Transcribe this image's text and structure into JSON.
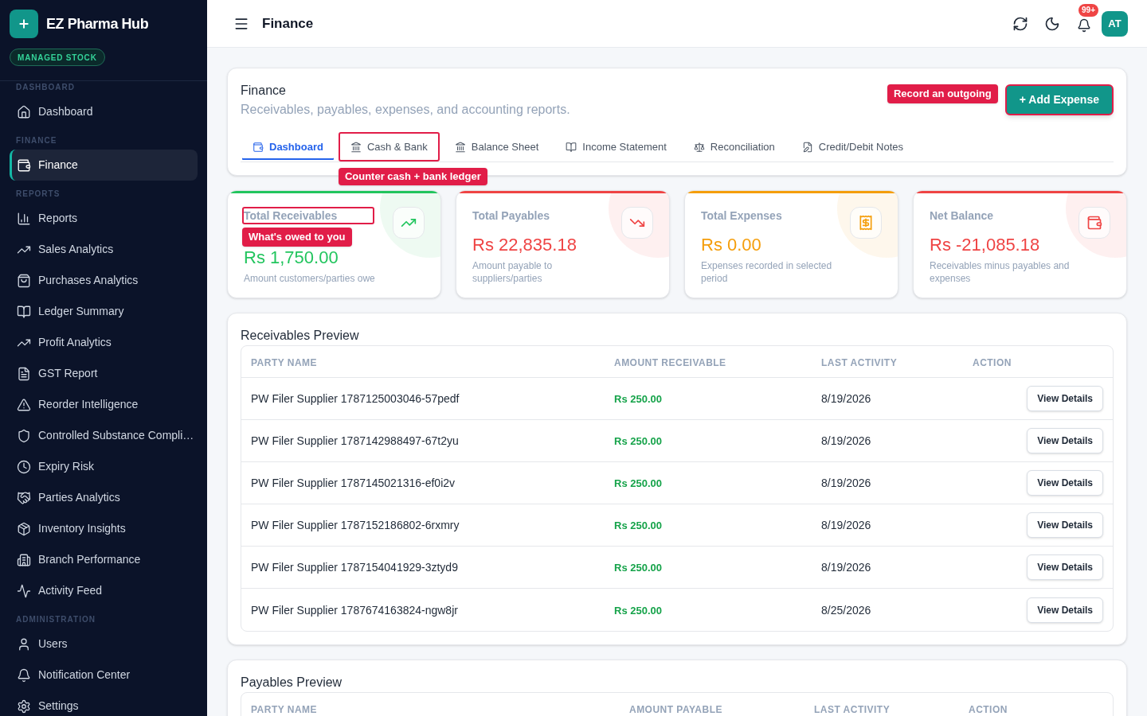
{
  "sidebar": {
    "brand": "EZ Pharma Hub",
    "badge": "MANAGED STOCK",
    "sections": [
      {
        "label": "DASHBOARD",
        "items": [
          {
            "label": "Dashboard",
            "selected": false
          }
        ]
      },
      {
        "label": "FINANCE",
        "items": [
          {
            "label": "Finance",
            "selected": true
          }
        ]
      },
      {
        "label": "REPORTS",
        "items": [
          {
            "label": "Reports",
            "selected": false
          },
          {
            "label": "Sales Analytics",
            "selected": false
          },
          {
            "label": "Purchases Analytics",
            "selected": false
          },
          {
            "label": "Ledger Summary",
            "selected": false
          },
          {
            "label": "Profit Analytics",
            "selected": false
          },
          {
            "label": "GST Report",
            "selected": false
          },
          {
            "label": "Reorder Intelligence",
            "selected": false
          },
          {
            "label": "Controlled Substance Compli…",
            "selected": false
          },
          {
            "label": "Expiry Risk",
            "selected": false
          },
          {
            "label": "Parties Analytics",
            "selected": false
          },
          {
            "label": "Inventory Insights",
            "selected": false
          },
          {
            "label": "Branch Performance",
            "selected": false
          },
          {
            "label": "Activity Feed",
            "selected": false
          }
        ]
      },
      {
        "label": "ADMINISTRATION",
        "items": [
          {
            "label": "Users",
            "selected": false
          },
          {
            "label": "Notification Center",
            "selected": false
          },
          {
            "label": "Settings",
            "selected": false
          }
        ]
      }
    ]
  },
  "header": {
    "title": "Finance",
    "notification_count": "99+",
    "avatar": "AT"
  },
  "finance_card": {
    "title": "Finance",
    "subtitle": "Receivables, payables, expenses, and accounting reports.",
    "add_button": {
      "label": "+ Add Expense",
      "highlighted": true,
      "tooltip": "Record an outgoing"
    },
    "tabs": [
      {
        "label": "Dashboard",
        "selected": true,
        "highlighted": false
      },
      {
        "label": "Cash & Bank",
        "selected": false,
        "highlighted": true,
        "tooltip": "Counter cash + bank ledger"
      },
      {
        "label": "Balance Sheet",
        "selected": false,
        "highlighted": false
      },
      {
        "label": "Income Statement",
        "selected": false,
        "highlighted": false
      },
      {
        "label": "Reconciliation",
        "selected": false,
        "highlighted": false
      },
      {
        "label": "Credit/Debit Notes",
        "selected": false,
        "highlighted": false
      }
    ]
  },
  "stat_cards": [
    {
      "title": "Total Receivables",
      "value": "Rs 1,750.00",
      "description": "Amount customers/parties owe",
      "color": "#22c55e",
      "highlighted": true,
      "tooltip": "What's owed to you"
    },
    {
      "title": "Total Payables",
      "value": "Rs 22,835.18",
      "description": "Amount payable to suppliers/parties",
      "color": "#ef4444",
      "highlighted": false
    },
    {
      "title": "Total Expenses",
      "value": "Rs 0.00",
      "description": "Expenses recorded in selected period",
      "color": "#f59e0b",
      "highlighted": false
    },
    {
      "title": "Net Balance",
      "value": "Rs -21,085.18",
      "description": "Receivables minus payables and expenses",
      "color": "#ef4444",
      "highlighted": false
    }
  ],
  "receivables_preview": {
    "title": "Receivables Preview",
    "columns": [
      "PARTY NAME",
      "AMOUNT RECEIVABLE",
      "LAST ACTIVITY",
      "ACTION"
    ],
    "rows": [
      {
        "party": "PW Filer Supplier 1787125003046-57pedf",
        "amount": "Rs 250.00",
        "last_activity": "8/19/2026",
        "action": "View Details"
      },
      {
        "party": "PW Filer Supplier 1787142988497-67t2yu",
        "amount": "Rs 250.00",
        "last_activity": "8/19/2026",
        "action": "View Details"
      },
      {
        "party": "PW Filer Supplier 1787145021316-ef0i2v",
        "amount": "Rs 250.00",
        "last_activity": "8/19/2026",
        "action": "View Details"
      },
      {
        "party": "PW Filer Supplier 1787152186802-6rxmry",
        "amount": "Rs 250.00",
        "last_activity": "8/19/2026",
        "action": "View Details"
      },
      {
        "party": "PW Filer Supplier 1787154041929-3ztyd9",
        "amount": "Rs 250.00",
        "last_activity": "8/19/2026",
        "action": "View Details"
      },
      {
        "party": "PW Filer Supplier 1787674163824-ngw8jr",
        "amount": "Rs 250.00",
        "last_activity": "8/25/2026",
        "action": "View Details"
      }
    ]
  },
  "payables_preview": {
    "title": "Payables Preview",
    "columns": [
      "PARTY NAME",
      "AMOUNT PAYABLE",
      "LAST ACTIVITY",
      "ACTION"
    ]
  }
}
